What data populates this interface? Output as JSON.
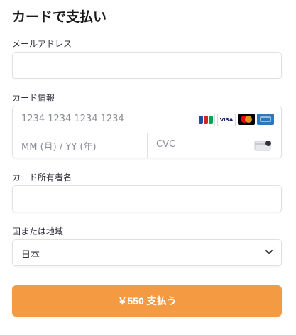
{
  "title": "カードで支払い",
  "email": {
    "label": "メールアドレス",
    "value": ""
  },
  "card": {
    "label": "カード情報",
    "number_placeholder": "1234 1234 1234 1234",
    "expiry_placeholder": "MM (月) / YY (年)",
    "cvc_placeholder": "CVC",
    "brands": [
      {
        "name": "JCB",
        "color": "#1a4ea3"
      },
      {
        "name": "VISA",
        "color": "#1a1f71"
      },
      {
        "name": "Mastercard",
        "color": "#eb001b"
      },
      {
        "name": "AMEX",
        "color": "#2e77bb"
      }
    ]
  },
  "cardholder": {
    "label": "カード所有者名",
    "value": ""
  },
  "country": {
    "label": "国または地域",
    "selected": "日本"
  },
  "pay_button": {
    "label": "￥550 支払う",
    "color": "#f39a43"
  }
}
